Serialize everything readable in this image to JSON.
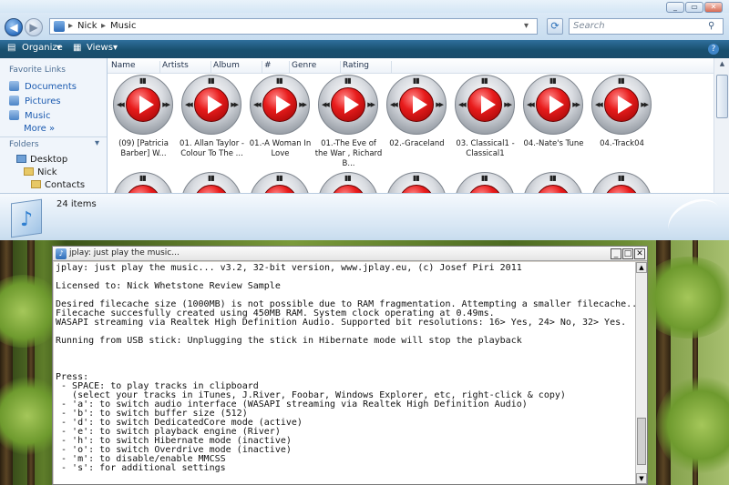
{
  "explorer": {
    "window_buttons": [
      "_",
      "▭",
      "✕"
    ],
    "breadcrumb": [
      "Nick",
      "Music"
    ],
    "search_placeholder": "Search",
    "toolbar": {
      "organize": "Organize",
      "views": "Views",
      "help": "?"
    },
    "nav": {
      "favorites_header": "Favorite Links",
      "favorites": [
        "Documents",
        "Pictures",
        "Music"
      ],
      "more": "More »",
      "folders_header": "Folders",
      "tree": [
        "Desktop",
        "Nick",
        "Contacts"
      ]
    },
    "columns": [
      "Name",
      "Artists",
      "Album",
      "#",
      "Genre",
      "Rating"
    ],
    "files_row1": [
      "(09) [Patricia Barber] W...",
      "01. Allan Taylor - Colour To The ...",
      "01.-A Woman In Love",
      "01.-The Eve of the War , Richard B...",
      "02.-Graceland",
      "03. Classical1 -Classical1",
      "04.-Nate's Tune",
      "04.-Track04"
    ],
    "details": {
      "count": "24 items"
    }
  },
  "console": {
    "title": "jplay: just play the music...",
    "buttons": [
      "_",
      "□",
      "✕"
    ],
    "lines": [
      "jplay: just play the music... v3.2, 32-bit version, www.jplay.eu, (c) Josef Piri 2011",
      "",
      "Licensed to: Nick Whetstone Review Sample",
      "",
      "Desired filecache size (1000MB) is not possible due to RAM fragmentation. Attempting a smaller filecache...",
      "Filecache succesfully created using 450MB RAM. System clock operating at 0.49ms.",
      "WASAPI streaming via Realtek High Definition Audio. Supported bit resolutions: 16> Yes, 24> No, 32> Yes.",
      "",
      "Running from USB stick: Unplugging the stick in Hibernate mode will stop the playback",
      "",
      "",
      "",
      "Press:",
      " - SPACE: to play tracks in clipboard",
      "   (select your tracks in iTunes, J.River, Foobar, Windows Explorer, etc, right-click & copy)",
      " - 'a': to switch audio interface (WASAPI streaming via Realtek High Definition Audio)",
      " - 'b': to switch buffer size (512)",
      " - 'd': to switch DedicatedCore mode (active)",
      " - 'e': to switch playback engine (River)",
      " - 'h': to switch Hibernate mode (inactive)",
      " - 'o': to switch Overdrive mode (inactive)",
      " - 'm': to disable/enable MMCSS",
      " - 's': for additional settings"
    ]
  }
}
